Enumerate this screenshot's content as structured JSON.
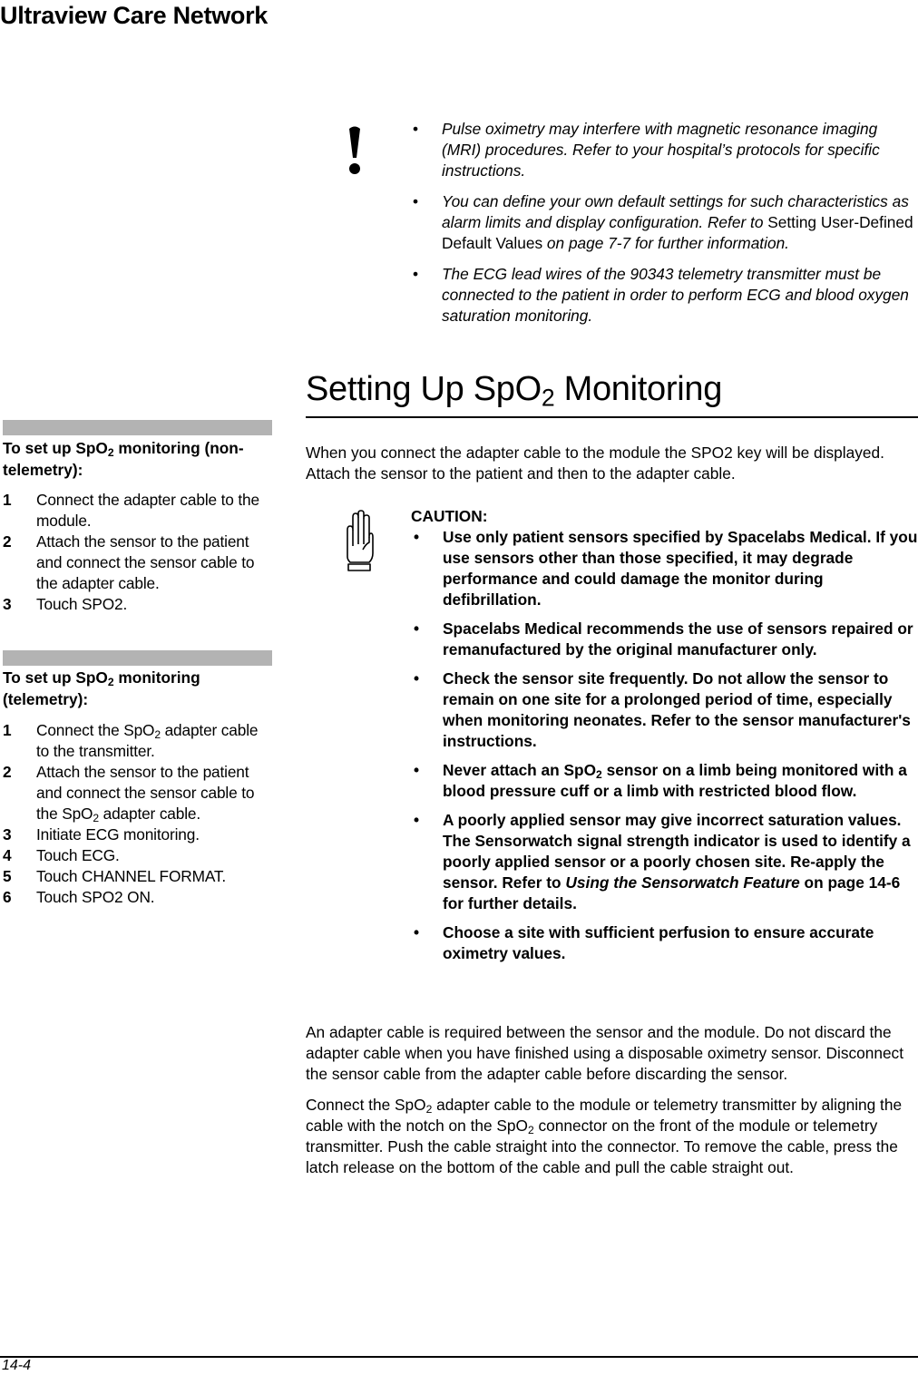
{
  "header": {
    "title": "Ultraview Care Network"
  },
  "note": {
    "icon": "exclamation-icon",
    "items": [
      {
        "text": "Pulse oximetry may interfere with magnetic resonance imaging (MRI) procedures. Refer to your hospital’s protocols for specific instructions."
      },
      {
        "pre": "You can define your own default settings for such characteristics as alarm limits and display configuration. Refer to ",
        "link": "Setting User-Defined Default Values",
        "post": " on page 7-7 for further information."
      },
      {
        "text": "The ECG lead wires of the 90343 telemetry transmitter must be connected to the patient in order to perform ECG and blood oxygen saturation monitoring."
      }
    ],
    "bullet": "•"
  },
  "section": {
    "title_pre": "Setting Up SpO",
    "title_sub": "2",
    "title_post": " Monitoring",
    "intro": "When you connect the adapter cable to the module the SPO2 key will be displayed. Attach the sensor to the patient and then to the adapter cable."
  },
  "caution": {
    "icon": "hand-stop-icon",
    "label": "CAUTION:",
    "bullet": "•",
    "items": [
      {
        "text": "Use only patient sensors specified by Spacelabs Medical. If you use sensors other than those specified, it may degrade performance and could damage the monitor during defibrillation."
      },
      {
        "text": "Spacelabs Medical recommends the use of sensors repaired or remanufactured by the original manufacturer only."
      },
      {
        "text": "Check the sensor site frequently. Do not allow the sensor to remain on one site for a prolonged period of time, especially when monitoring neonates. Refer to the sensor manufacturer's instructions."
      },
      {
        "pre": "Never attach an SpO",
        "sub": "2",
        "post": " sensor on a limb being monitored with a blood pressure cuff or a limb with restricted blood flow."
      },
      {
        "pre": "A poorly applied sensor may give incorrect saturation values. The Sensorwatch signal strength indicator is used to identify a poorly applied sensor or a poorly chosen site. Re-apply the sensor. Refer to ",
        "link": "Using the Sensorwatch Feature",
        "post": " on page 14-6 for further details."
      },
      {
        "text": "Choose a site with sufficient perfusion to ensure accurate oximetry values."
      }
    ]
  },
  "body": {
    "adapter_para": "An adapter cable is required between the sensor and the module. Do not discard the adapter cable when you have finished using a disposable oximetry sensor. Disconnect the sensor cable from the adapter cable before discarding the sensor.",
    "connect_para": {
      "p1": "Connect the SpO",
      "s1": "2",
      "p2": " adapter cable to the module or telemetry transmitter by aligning the cable with the notch on the SpO",
      "s2": "2",
      "p3": " connector on the front of the module or telemetry transmitter. Push the cable straight into the connector. To remove the cable, press the latch release on the bottom of the cable and pull the cable straight out."
    }
  },
  "sidebar": {
    "procedures": [
      {
        "heading_pre": "To set up SpO",
        "heading_sub": "2",
        "heading_post": " monitoring (non-telemetry):",
        "steps": [
          {
            "num": "1",
            "text": "Connect the adapter cable to the module."
          },
          {
            "num": "2",
            "text": "Attach the sensor to the patient and connect the sensor cable to the adapter cable."
          },
          {
            "num": "3",
            "text": "Touch SPO2."
          }
        ]
      },
      {
        "heading_pre": "To set up SpO",
        "heading_sub": "2",
        "heading_post": " monitoring (telemetry):",
        "steps": [
          {
            "num": "1",
            "pre": "Connect the SpO",
            "sub": "2",
            "post": " adapter cable to the transmitter."
          },
          {
            "num": "2",
            "pre": "Attach the sensor to the patient and connect the sensor cable to the SpO",
            "sub": "2",
            "post": " adapter cable."
          },
          {
            "num": "3",
            "text": "Initiate ECG monitoring."
          },
          {
            "num": "4",
            "text": "Touch ECG."
          },
          {
            "num": "5",
            "text": "Touch CHANNEL FORMAT."
          },
          {
            "num": "6",
            "text": "Touch SPO2 ON."
          }
        ]
      }
    ]
  },
  "footer": {
    "page_number": "14-4"
  }
}
